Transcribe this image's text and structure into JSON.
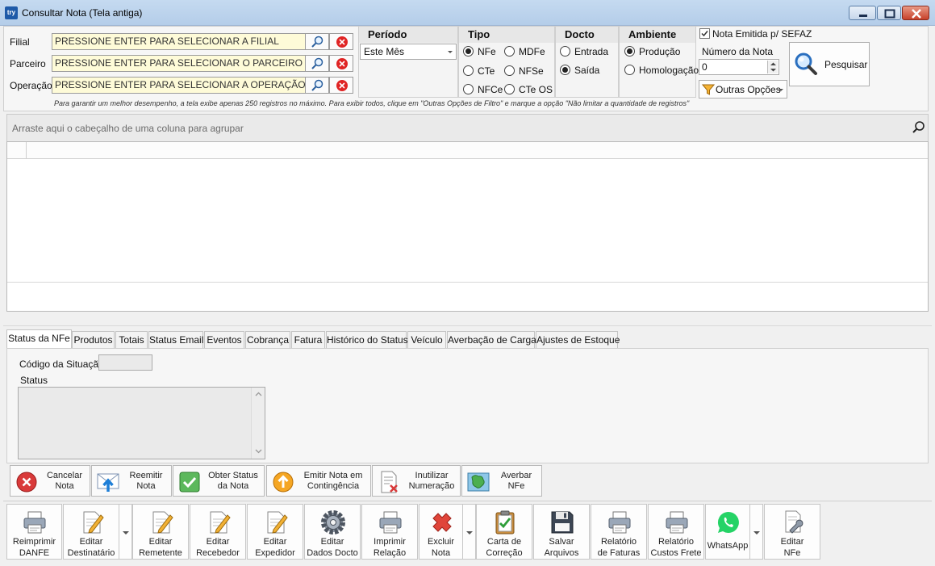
{
  "window": {
    "logo": "try",
    "title": "Consultar Nota (Tela antiga)"
  },
  "filters": {
    "filial": {
      "label": "Filial",
      "value": "PRESSIONE ENTER PARA SELECIONAR A FILIAL"
    },
    "parceiro": {
      "label": "Parceiro",
      "value": "PRESSIONE ENTER PARA SELECIONAR O PARCEIRO"
    },
    "operacao": {
      "label": "Operação",
      "value": "PRESSIONE ENTER PARA SELECIONAR A OPERAÇÃO"
    },
    "note": "Para garantir um melhor desempenho, a tela exibe apenas 250 registros no máximo. Para exibir todos, clique em \"Outras Opções de Filtro\" e marque a opção \"Não limitar a quantidade de registros\""
  },
  "periodo": {
    "header": "Período",
    "value": "Este Mês"
  },
  "tipo": {
    "header": "Tipo",
    "options": [
      "NFe",
      "MDFe",
      "CTe",
      "NFSe",
      "NFCe",
      "CTe OS"
    ],
    "selected": "NFe"
  },
  "docto": {
    "header": "Docto",
    "options": [
      "Entrada",
      "Saída"
    ],
    "selected": "Saída"
  },
  "ambiente": {
    "header": "Ambiente",
    "options": [
      "Produção",
      "Homologação"
    ],
    "selected": "Produção"
  },
  "sefaz": {
    "label": "Nota Emitida p/ SEFAZ",
    "checked": true
  },
  "numero_nota": {
    "label": "Número da Nota",
    "value": "0"
  },
  "outras_opcoes": "Outras Opções",
  "pesquisar": "Pesquisar",
  "grid": {
    "group_hint": "Arraste aqui o cabeçalho de uma coluna para agrupar"
  },
  "tabs": [
    "Status da NFe",
    "Produtos",
    "Totais",
    "Status Email",
    "Eventos",
    "Cobrança",
    "Fatura",
    "Histórico do Status",
    "Veículo",
    "Averbação de Carga",
    "Ajustes de Estoque"
  ],
  "status_tab": {
    "codigo_label": "Código da Situação",
    "codigo_value": "",
    "status_label": "Status",
    "status_value": ""
  },
  "actions": [
    {
      "line1": "Cancelar",
      "line2": "Nota"
    },
    {
      "line1": "Reemitir",
      "line2": "Nota"
    },
    {
      "line1": "Obter Status",
      "line2": "da Nota"
    },
    {
      "line1": "Emitir Nota em",
      "line2": "Contingência"
    },
    {
      "line1": "Inutilizar",
      "line2": "Numeração"
    },
    {
      "line1": "Averbar",
      "line2": "NFe"
    }
  ],
  "toolbar": [
    {
      "line1": "Reimprimir",
      "line2": "DANFE"
    },
    {
      "line1": "Editar",
      "line2": "Destinatário"
    },
    {
      "line1": "Editar",
      "line2": "Remetente"
    },
    {
      "line1": "Editar",
      "line2": "Recebedor"
    },
    {
      "line1": "Editar",
      "line2": "Expedidor"
    },
    {
      "line1": "Editar",
      "line2": "Dados Docto"
    },
    {
      "line1": "Imprimir",
      "line2": "Relação"
    },
    {
      "line1": "Excluir",
      "line2": "Nota"
    },
    {
      "line1": "Carta de",
      "line2": "Correção"
    },
    {
      "line1": "Salvar",
      "line2": "Arquivos"
    },
    {
      "line1": "Relatório",
      "line2": "de Faturas"
    },
    {
      "line1": "Relatório",
      "line2": "Custos Frete"
    },
    {
      "line1": "WhatsApp",
      "line2": ""
    },
    {
      "line1": "Editar",
      "line2": "NFe"
    }
  ]
}
